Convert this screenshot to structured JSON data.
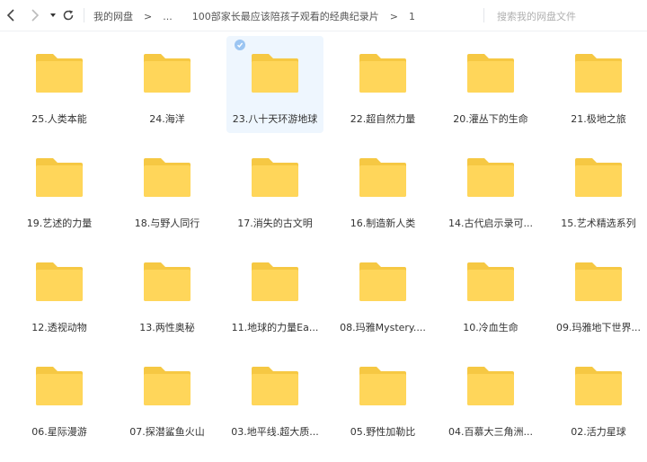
{
  "toolbar": {
    "back_icon": "chevron-left-icon",
    "forward_icon": "chevron-right-icon",
    "history_icon": "caret-down-icon",
    "refresh_icon": "refresh-icon",
    "breadcrumb": {
      "root": "我的网盘",
      "separator": ">",
      "ellipsis": "...",
      "parent": "100部家长最应该陪孩子观看的经典纪录片",
      "current": "1"
    },
    "search_placeholder": "搜索我的网盘文件"
  },
  "colors": {
    "folder_back": "#F6C843",
    "folder_front": "#FFD65A",
    "selected_bg": "#EEF6FE",
    "check": "#9BC5F2"
  },
  "folders": [
    {
      "label": "25.人类本能",
      "selected": false
    },
    {
      "label": "24.海洋",
      "selected": false
    },
    {
      "label": "23.八十天环游地球",
      "selected": true
    },
    {
      "label": "22.超自然力量",
      "selected": false
    },
    {
      "label": "20.灌丛下的生命",
      "selected": false
    },
    {
      "label": "21.极地之旅",
      "selected": false
    },
    {
      "label": "19.艺述的力量",
      "selected": false
    },
    {
      "label": "18.与野人同行",
      "selected": false
    },
    {
      "label": "17.消失的古文明",
      "selected": false
    },
    {
      "label": "16.制造新人类",
      "selected": false
    },
    {
      "label": "14.古代启示录可...",
      "selected": false
    },
    {
      "label": "15.艺术精选系列",
      "selected": false
    },
    {
      "label": "12.透视动物",
      "selected": false
    },
    {
      "label": "13.两性奥秘",
      "selected": false
    },
    {
      "label": "11.地球的力量Ea...",
      "selected": false
    },
    {
      "label": "08.玛雅Mystery....",
      "selected": false
    },
    {
      "label": "10.冷血生命",
      "selected": false
    },
    {
      "label": "09.玛雅地下世界...",
      "selected": false
    },
    {
      "label": "06.星际漫游",
      "selected": false
    },
    {
      "label": "07.探潜鲨鱼火山",
      "selected": false
    },
    {
      "label": "03.地平线.超大质...",
      "selected": false
    },
    {
      "label": "05.野性加勒比",
      "selected": false
    },
    {
      "label": "04.百慕大三角洲...",
      "selected": false
    },
    {
      "label": "02.活力星球",
      "selected": false
    }
  ]
}
